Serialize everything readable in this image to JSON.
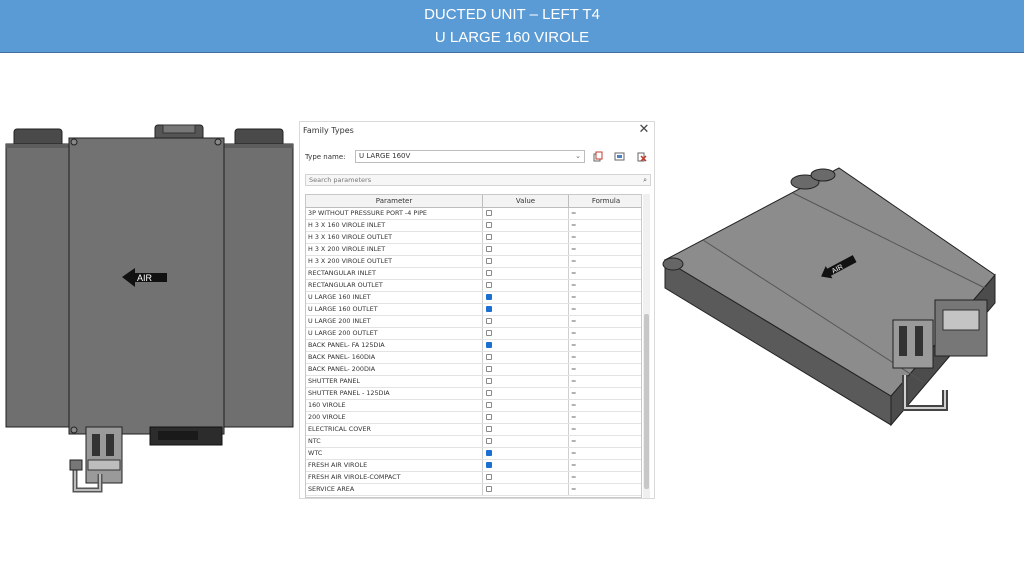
{
  "banner": {
    "line1": "DUCTED UNIT – LEFT  T4",
    "line2": "U LARGE 160 VIROLE"
  },
  "left_unit": {
    "arrow_label": "AIR"
  },
  "iso_unit": {
    "arrow_label": "AIR"
  },
  "dialog": {
    "title": "Family Types",
    "close_icon": "close-icon",
    "type_name_label": "Type name:",
    "type_name_value": "U LARGE 160V",
    "search_placeholder": "Search parameters",
    "columns": [
      "Parameter",
      "Value",
      "Formula"
    ],
    "rows": [
      {
        "parameter": "3P WITHOUT PRESSURE PORT -4  PIPE",
        "checked": false,
        "formula": "="
      },
      {
        "parameter": "H  3 X 160 VIROLE INLET",
        "checked": false,
        "formula": "="
      },
      {
        "parameter": "H  3 X 160 VIROLE OUTLET",
        "checked": false,
        "formula": "="
      },
      {
        "parameter": "H  3 X 200 VIROLE INLET",
        "checked": false,
        "formula": "="
      },
      {
        "parameter": "H  3 X 200 VIROLE OUTLET",
        "checked": false,
        "formula": "="
      },
      {
        "parameter": "RECTANGULAR INLET",
        "checked": false,
        "formula": "="
      },
      {
        "parameter": "RECTANGULAR OUTLET",
        "checked": false,
        "formula": "="
      },
      {
        "parameter": "U LARGE 160 INLET",
        "checked": true,
        "formula": "="
      },
      {
        "parameter": "U LARGE 160 OUTLET",
        "checked": true,
        "formula": "="
      },
      {
        "parameter": "U LARGE 200 INLET",
        "checked": false,
        "formula": "="
      },
      {
        "parameter": "U LARGE 200 OUTLET",
        "checked": false,
        "formula": "="
      },
      {
        "parameter": "BACK PANEL- FA 125DIA",
        "checked": true,
        "formula": "="
      },
      {
        "parameter": "BACK PANEL- 160DIA",
        "checked": false,
        "formula": "="
      },
      {
        "parameter": "BACK PANEL- 200DIA",
        "checked": false,
        "formula": "="
      },
      {
        "parameter": "SHUTTER PANEL",
        "checked": false,
        "formula": "="
      },
      {
        "parameter": "SHUTTER PANEL - 125DIA",
        "checked": false,
        "formula": "="
      },
      {
        "parameter": "160 VIROLE",
        "checked": false,
        "formula": "="
      },
      {
        "parameter": "200 VIROLE",
        "checked": false,
        "formula": "="
      },
      {
        "parameter": "ELECTRICAL COVER",
        "checked": false,
        "formula": "="
      },
      {
        "parameter": "NTC",
        "checked": false,
        "formula": "="
      },
      {
        "parameter": "WTC",
        "checked": true,
        "formula": "="
      },
      {
        "parameter": "FRESH AIR VIROLE",
        "checked": true,
        "formula": "="
      },
      {
        "parameter": "FRESH AIR VIROLE-COMPACT",
        "checked": false,
        "formula": "="
      },
      {
        "parameter": "SERVICE AREA",
        "checked": false,
        "formula": "="
      }
    ]
  },
  "colors": {
    "banner": "#5b9bd5",
    "unit_body": "#6f6f6f",
    "checkbox_on": "#1a6fd1"
  }
}
